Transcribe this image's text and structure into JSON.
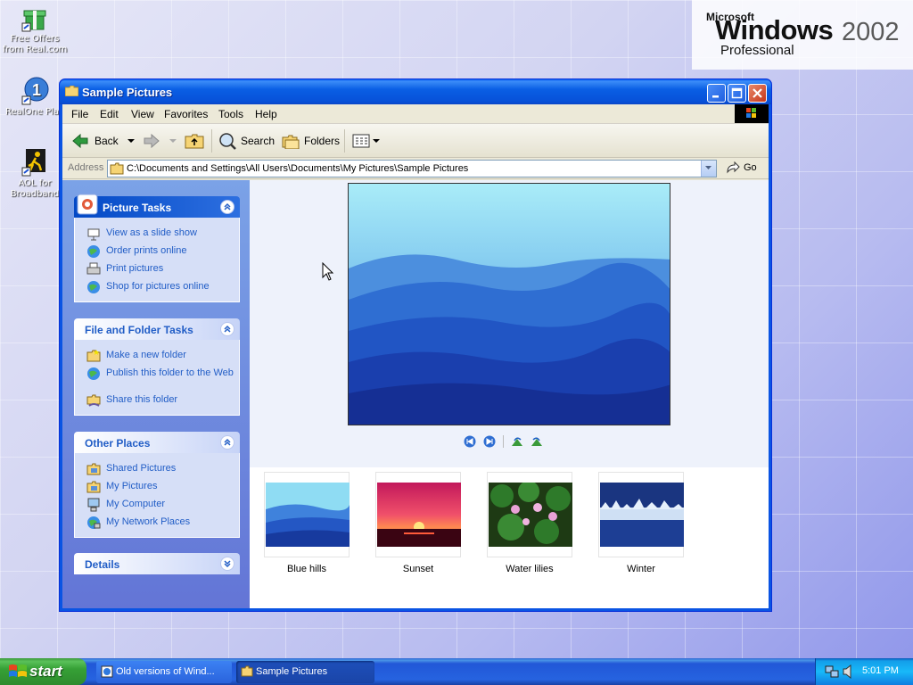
{
  "desktop": {
    "brand": {
      "microsoft": "Microsoft",
      "windows": "Windows",
      "year": "2002",
      "edition": "Professional"
    },
    "icons": [
      {
        "label_line1": "Free Offers",
        "label_line2": "from Real.com"
      },
      {
        "label_line1": "RealOne Play",
        "label_line2": ""
      },
      {
        "label_line1": "AOL for",
        "label_line2": "Broadband"
      }
    ]
  },
  "window": {
    "title": "Sample Pictures",
    "menu": [
      "File",
      "Edit",
      "View",
      "Favorites",
      "Tools",
      "Help"
    ],
    "toolbar": {
      "back": "Back",
      "search": "Search",
      "folders": "Folders"
    },
    "address": {
      "label": "Address",
      "path": "C:\\Documents and Settings\\All Users\\Documents\\My Pictures\\Sample Pictures",
      "go": "Go"
    },
    "panels": {
      "picture_tasks": {
        "title": "Picture Tasks",
        "items": [
          "View as a slide show",
          "Order prints online",
          "Print pictures",
          "Shop for pictures online"
        ]
      },
      "file_folder_tasks": {
        "title": "File and Folder Tasks",
        "items": [
          "Make a new folder",
          "Publish this folder to the Web",
          "Share this folder"
        ]
      },
      "other_places": {
        "title": "Other Places",
        "items": [
          "Shared Pictures",
          "My Pictures",
          "My Computer",
          "My Network Places"
        ]
      },
      "details": {
        "title": "Details"
      }
    },
    "thumbnails": [
      "Blue hills",
      "Sunset",
      "Water lilies",
      "Winter"
    ]
  },
  "taskbar": {
    "start": "start",
    "tasks": [
      "Old versions of Wind...",
      "Sample Pictures"
    ],
    "clock": "5:01 PM"
  },
  "colors": {
    "accent": "#0a54e3",
    "link": "#215dc6",
    "start_green": "#36a036"
  }
}
